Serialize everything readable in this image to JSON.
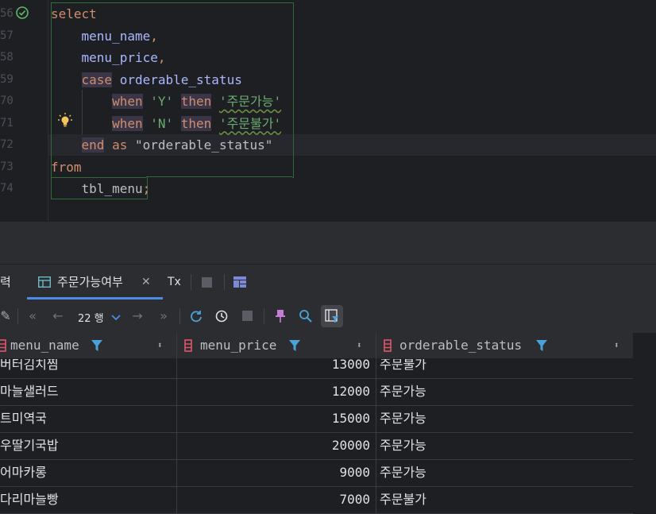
{
  "editor": {
    "line_numbers": [
      "56",
      "57",
      "58",
      "59",
      "70",
      "71",
      "72",
      "73",
      "74"
    ],
    "lines": [
      [
        {
          "t": "select",
          "c": "kw"
        }
      ],
      [
        {
          "t": "    ",
          "c": "id2"
        },
        {
          "t": "menu_name",
          "c": "id"
        },
        {
          "t": ",",
          "c": "kw"
        }
      ],
      [
        {
          "t": "    ",
          "c": "id2"
        },
        {
          "t": "menu_price",
          "c": "id"
        },
        {
          "t": ",",
          "c": "kw"
        }
      ],
      [
        {
          "t": "    ",
          "c": "id2"
        },
        {
          "t": "case",
          "c": "kwhl"
        },
        {
          "t": " ",
          "c": "id2"
        },
        {
          "t": "orderable_status",
          "c": "id"
        }
      ],
      [
        {
          "t": "        ",
          "c": "id2"
        },
        {
          "t": "when",
          "c": "kwhl"
        },
        {
          "t": " ",
          "c": "id2"
        },
        {
          "t": "'Y'",
          "c": "str"
        },
        {
          "t": " ",
          "c": "id2"
        },
        {
          "t": "then",
          "c": "kwhl"
        },
        {
          "t": " ",
          "c": "id2"
        },
        {
          "t": "'주문가능'",
          "c": "str wavy"
        }
      ],
      [
        {
          "t": "        ",
          "c": "id2"
        },
        {
          "t": "when",
          "c": "kwhl"
        },
        {
          "t": " ",
          "c": "id2"
        },
        {
          "t": "'N'",
          "c": "str"
        },
        {
          "t": " ",
          "c": "id2"
        },
        {
          "t": "then",
          "c": "kwhl"
        },
        {
          "t": " ",
          "c": "id2"
        },
        {
          "t": "'주문불가'",
          "c": "str wavy"
        }
      ],
      [
        {
          "t": "    ",
          "c": "id2"
        },
        {
          "t": "end",
          "c": "kwhl"
        },
        {
          "t": " ",
          "c": "id2"
        },
        {
          "t": "as",
          "c": "kw"
        },
        {
          "t": " \"orderable_status\"",
          "c": "id2"
        }
      ],
      [
        {
          "t": "from",
          "c": "kw"
        }
      ],
      [
        {
          "t": "    ",
          "c": "id2"
        },
        {
          "t": "tbl_menu",
          "c": "id2"
        },
        {
          "t": ";",
          "c": "kw"
        }
      ]
    ]
  },
  "tabs": {
    "left_partial": "력",
    "active_tab": "주문가능여부",
    "tx_label": "Tx"
  },
  "toolbar": {
    "rows_label": "22 행"
  },
  "grid": {
    "columns": [
      "menu_name",
      "menu_price",
      "orderable_status"
    ],
    "rows": [
      [
        "버터김치찜",
        "13000",
        "주문불가"
      ],
      [
        "마늘샐러드",
        "12000",
        "주문가능"
      ],
      [
        "트미역국",
        "15000",
        "주문가능"
      ],
      [
        "우딸기국밥",
        "20000",
        "주문가능"
      ],
      [
        "어마카롱",
        "9000",
        "주문가능"
      ],
      [
        "다리마늘빵",
        "7000",
        "주문불가"
      ]
    ]
  },
  "colors": {
    "accent": "#4a8ce8",
    "keyword": "#cf8e6d",
    "string": "#6aab73",
    "identifier": "#a9b7ff"
  }
}
